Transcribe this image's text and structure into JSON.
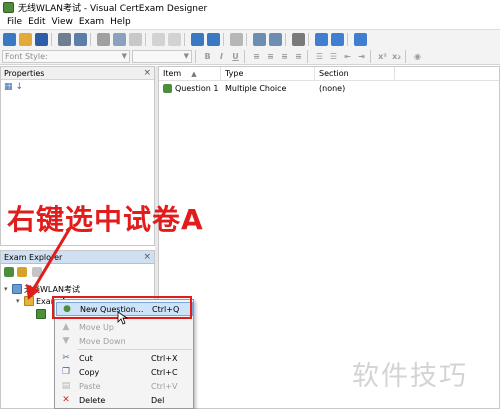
{
  "window": {
    "title": "无线WLAN考试 - Visual CertExam Designer"
  },
  "menubar": {
    "items": [
      "File",
      "Edit",
      "View",
      "Exam",
      "Help"
    ]
  },
  "format_toolbar": {
    "font_style_placeholder": "Font Style:",
    "buttons": [
      "B",
      "I",
      "U",
      "x²",
      "x₂"
    ]
  },
  "properties_panel": {
    "title": "Properties"
  },
  "explorer_panel": {
    "title": "Exam Explorer",
    "tree": [
      {
        "label": "无线WLAN考试",
        "level": 0
      },
      {
        "label": "Exam A",
        "level": 1
      }
    ]
  },
  "question_list": {
    "columns": [
      "Item",
      "Type",
      "Section"
    ],
    "rows": [
      {
        "item": "Question 1",
        "type": "Multiple Choice",
        "section": "(none)"
      }
    ]
  },
  "context_menu": {
    "items": [
      {
        "label": "New Question...",
        "shortcut": "Ctrl+Q",
        "enabled": true,
        "icon": "new-question-icon"
      },
      {
        "label": "Move Up",
        "shortcut": "",
        "enabled": false,
        "icon": "arrow-up-icon"
      },
      {
        "label": "Move Down",
        "shortcut": "",
        "enabled": false,
        "icon": "arrow-down-icon"
      },
      {
        "label": "Cut",
        "shortcut": "Ctrl+X",
        "enabled": true,
        "icon": "scissors-icon"
      },
      {
        "label": "Copy",
        "shortcut": "Ctrl+C",
        "enabled": true,
        "icon": "copy-icon"
      },
      {
        "label": "Paste",
        "shortcut": "Ctrl+V",
        "enabled": false,
        "icon": "paste-icon"
      },
      {
        "label": "Delete",
        "shortcut": "Del",
        "enabled": true,
        "icon": "delete-icon"
      }
    ]
  },
  "annotation": {
    "text": "右键选中试卷A",
    "color": "#e21b1b"
  },
  "watermark": {
    "text": "软件技巧"
  }
}
